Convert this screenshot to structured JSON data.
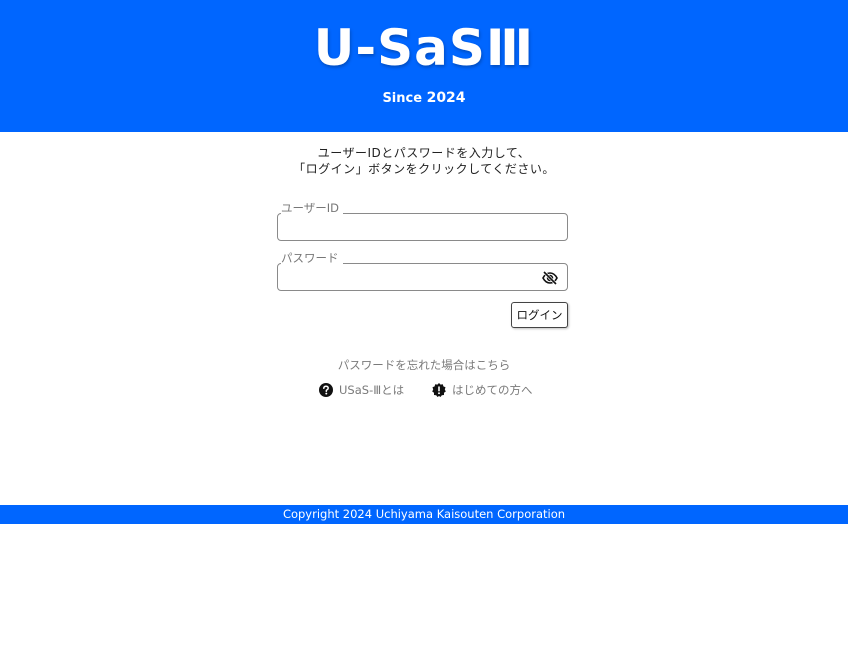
{
  "header": {
    "logo": "U-SaSⅢ",
    "since_label": "Since",
    "since_year": "2024",
    "colors": {
      "brand_blue": "#0066ff"
    }
  },
  "instructions": {
    "line1": "ユーザーIDとパスワードを入力して、",
    "line2": "「ログイン」ボタンをクリックしてください。"
  },
  "form": {
    "user_id_label": "ユーザーID",
    "user_id_value": "",
    "password_label": "パスワード",
    "password_value": "",
    "password_toggle_icon": "eye-off-icon",
    "login_button": "ログイン"
  },
  "links": {
    "forgot_password": "パスワードを忘れた場合はこちら",
    "about": "USaS-Ⅲとは",
    "about_icon": "question-circle-icon",
    "first_time": "はじめての方へ",
    "first_time_icon": "exclamation-badge-icon"
  },
  "footer": {
    "copyright": "Copyright 2024 Uchiyama Kaisouten Corporation"
  }
}
